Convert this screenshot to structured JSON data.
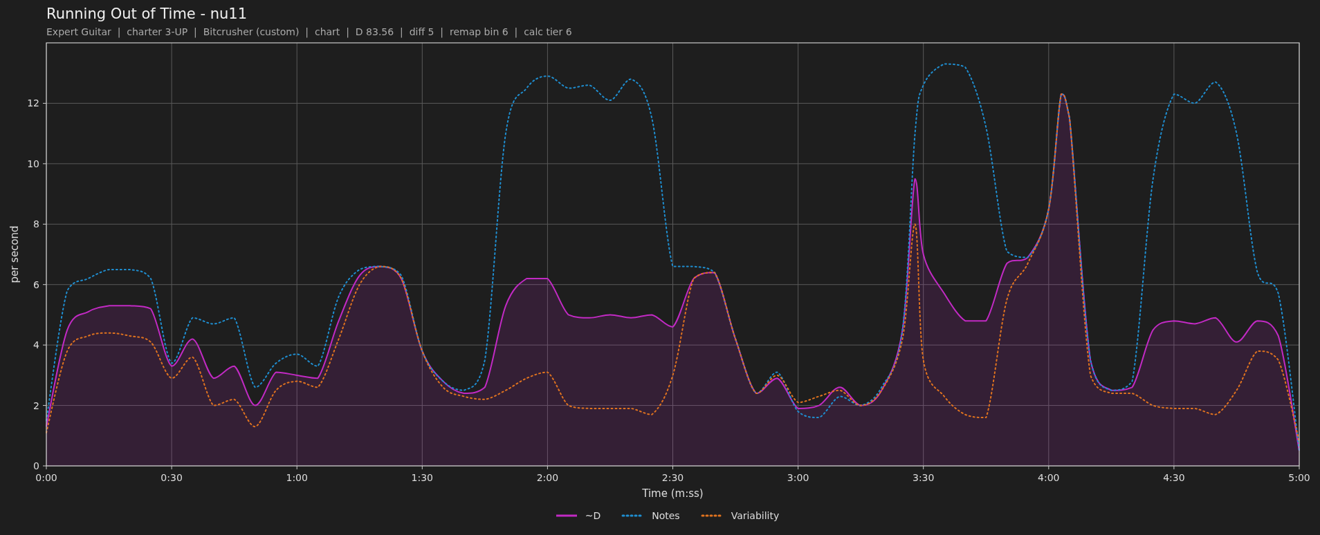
{
  "header": {
    "title": "Running Out of Time - nu11",
    "subtitle": "Expert Guitar  |  charter 3-UP  |  Bitcrusher (custom)  |  chart  |  D 83.56  |  diff 5  |  remap bin 6  |  calc tier 6"
  },
  "chart_data": {
    "type": "line",
    "xlabel": "Time (m:ss)",
    "ylabel": "per second",
    "xlim": [
      0,
      300
    ],
    "ylim": [
      0,
      14
    ],
    "grid": true,
    "xticks": [
      {
        "value": 0,
        "label": "0:00"
      },
      {
        "value": 30,
        "label": "0:30"
      },
      {
        "value": 60,
        "label": "1:00"
      },
      {
        "value": 90,
        "label": "1:30"
      },
      {
        "value": 120,
        "label": "2:00"
      },
      {
        "value": 150,
        "label": "2:30"
      },
      {
        "value": 180,
        "label": "3:00"
      },
      {
        "value": 210,
        "label": "3:30"
      },
      {
        "value": 240,
        "label": "4:00"
      },
      {
        "value": 270,
        "label": "4:30"
      },
      {
        "value": 300,
        "label": "5:00"
      }
    ],
    "yticks": [
      0,
      2,
      4,
      6,
      8,
      10,
      12
    ],
    "x": [
      0,
      5,
      10,
      15,
      20,
      25,
      30,
      35,
      40,
      45,
      50,
      55,
      60,
      65,
      70,
      75,
      80,
      85,
      90,
      95,
      100,
      105,
      110,
      115,
      120,
      125,
      130,
      135,
      140,
      145,
      150,
      155,
      160,
      165,
      170,
      175,
      180,
      185,
      190,
      195,
      200,
      205,
      208,
      210,
      215,
      220,
      225,
      230,
      235,
      240,
      243,
      245,
      250,
      255,
      260,
      265,
      270,
      275,
      280,
      285,
      290,
      295,
      300
    ],
    "series": [
      {
        "name": "~D",
        "color": "#c22ac4",
        "type": "area",
        "line_style": "solid",
        "values": [
          1.3,
          4.5,
          5.1,
          5.3,
          5.3,
          5.2,
          3.3,
          4.2,
          2.9,
          3.3,
          2.0,
          3.1,
          3.0,
          2.9,
          4.8,
          6.3,
          6.6,
          6.2,
          3.8,
          2.8,
          2.4,
          2.6,
          5.3,
          6.2,
          6.2,
          5.0,
          4.9,
          5.0,
          4.9,
          5.0,
          4.6,
          6.2,
          6.4,
          4.2,
          2.4,
          2.9,
          1.9,
          2.0,
          2.6,
          2.0,
          2.5,
          4.5,
          9.5,
          7.0,
          5.7,
          4.8,
          4.8,
          6.7,
          6.9,
          8.5,
          12.3,
          11.5,
          3.5,
          2.5,
          2.6,
          4.5,
          4.8,
          4.7,
          4.9,
          4.1,
          4.8,
          4.3,
          0.5
        ]
      },
      {
        "name": "Notes",
        "color": "#1f8ed0",
        "type": "line",
        "line_style": "dotted",
        "values": [
          1.5,
          5.8,
          6.2,
          6.5,
          6.5,
          6.2,
          3.4,
          4.9,
          4.7,
          4.9,
          2.6,
          3.4,
          3.7,
          3.3,
          5.6,
          6.5,
          6.6,
          6.3,
          3.8,
          2.8,
          2.5,
          3.5,
          11.0,
          12.5,
          12.9,
          12.5,
          12.6,
          12.1,
          12.8,
          11.5,
          6.6,
          6.6,
          6.4,
          4.2,
          2.4,
          3.1,
          1.8,
          1.6,
          2.3,
          2.0,
          2.6,
          4.5,
          11.0,
          12.6,
          13.3,
          13.2,
          11.2,
          7.1,
          6.9,
          8.5,
          12.3,
          11.5,
          3.5,
          2.5,
          2.8,
          9.5,
          12.3,
          12.0,
          12.7,
          11.0,
          6.4,
          5.7,
          0.5
        ]
      },
      {
        "name": "Variability",
        "color": "#e0731f",
        "type": "line",
        "line_style": "dotted",
        "values": [
          1.1,
          3.8,
          4.3,
          4.4,
          4.3,
          4.1,
          2.9,
          3.6,
          2.0,
          2.2,
          1.3,
          2.5,
          2.8,
          2.6,
          4.2,
          6.0,
          6.6,
          6.2,
          3.8,
          2.6,
          2.3,
          2.2,
          2.5,
          2.9,
          3.1,
          2.0,
          1.9,
          1.9,
          1.9,
          1.7,
          3.0,
          6.2,
          6.4,
          4.2,
          2.4,
          3.0,
          2.1,
          2.3,
          2.5,
          2.0,
          2.5,
          4.2,
          8.0,
          3.5,
          2.3,
          1.7,
          1.6,
          5.5,
          6.7,
          8.5,
          12.3,
          11.5,
          3.0,
          2.4,
          2.4,
          2.0,
          1.9,
          1.9,
          1.7,
          2.5,
          3.8,
          3.5,
          0.8
        ]
      }
    ]
  }
}
